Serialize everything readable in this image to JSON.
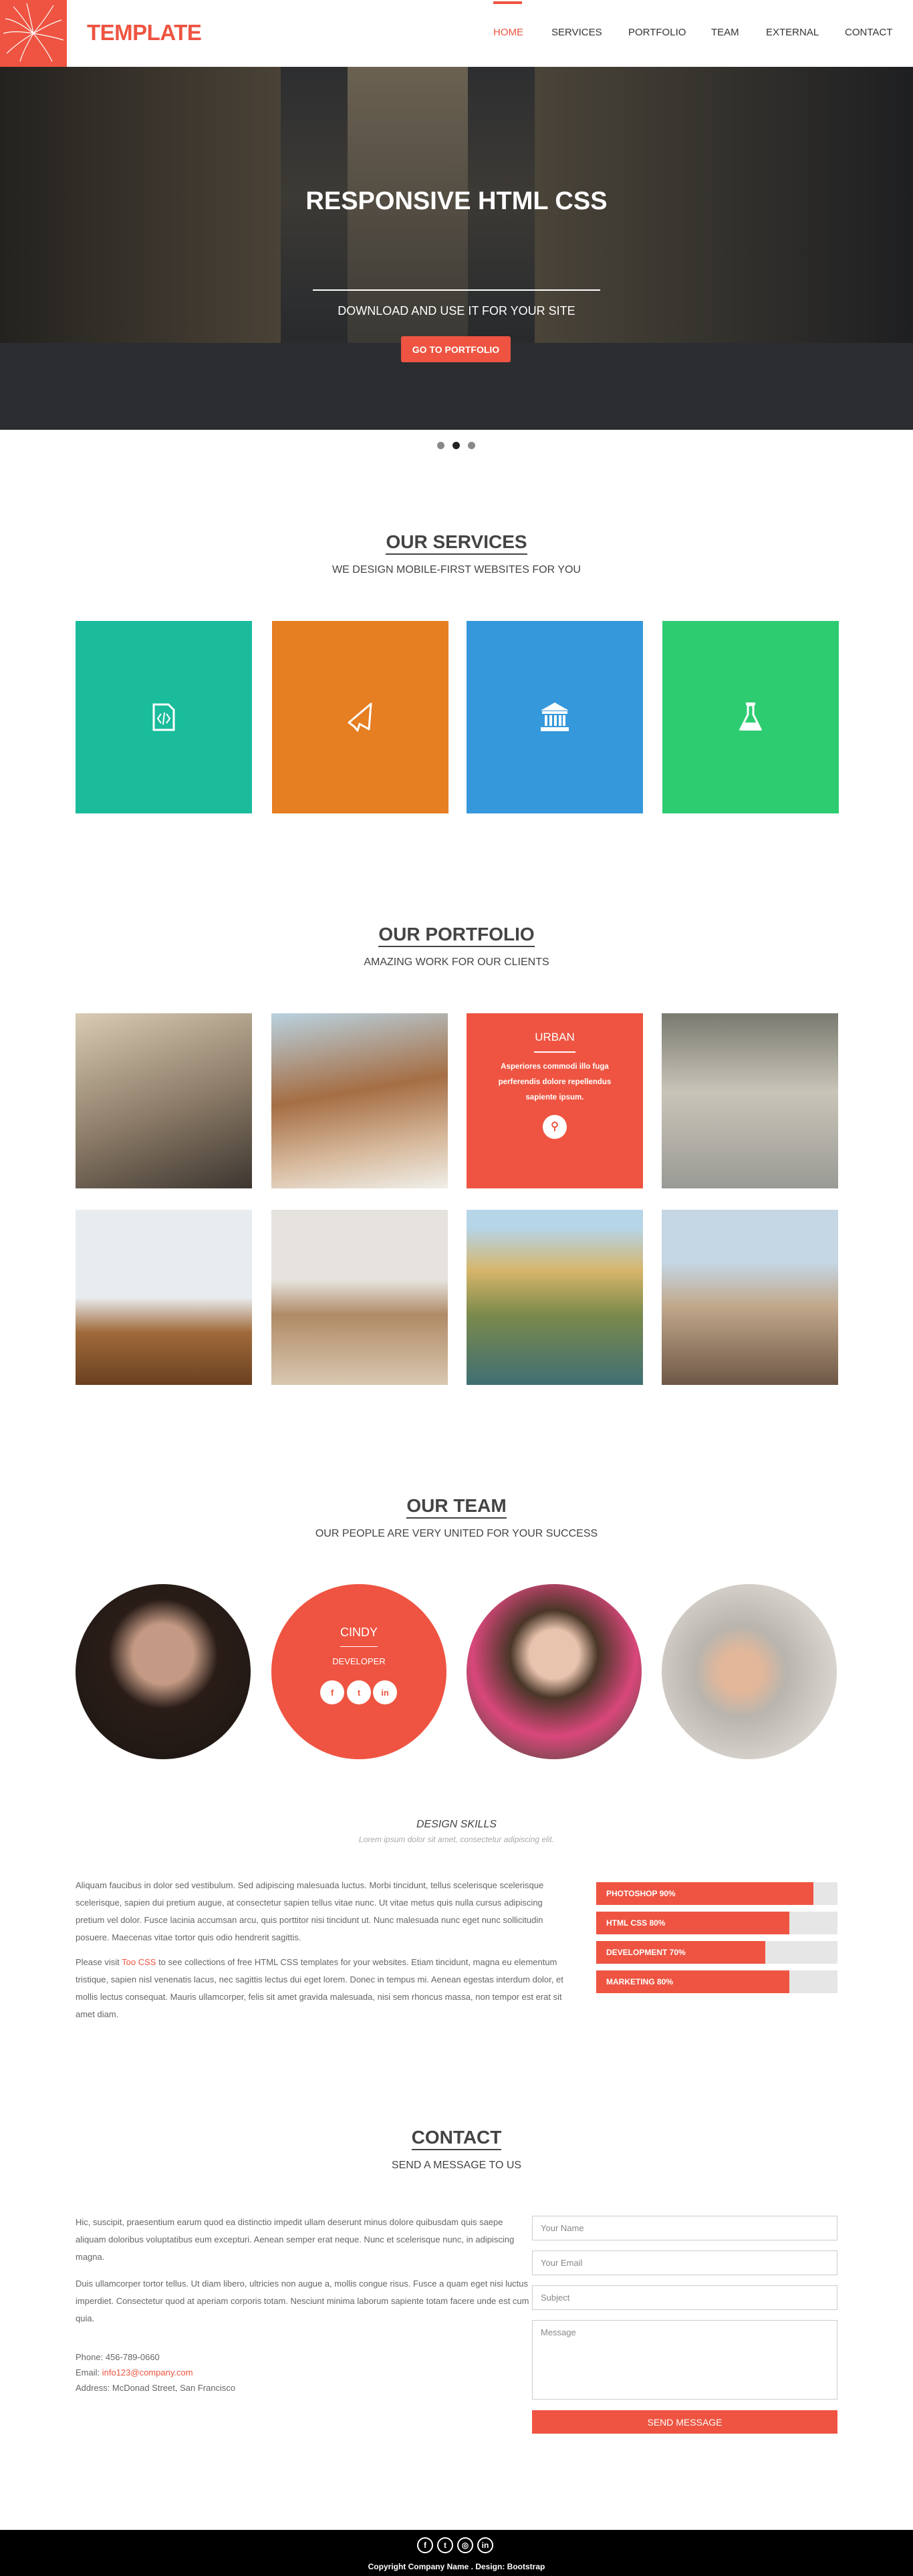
{
  "header": {
    "brand": "TEMPLATE",
    "nav": [
      {
        "label": "HOME",
        "active": true
      },
      {
        "label": "SERVICES"
      },
      {
        "label": "PORTFOLIO"
      },
      {
        "label": "TEAM"
      },
      {
        "label": "EXTERNAL"
      },
      {
        "label": "CONTACT"
      }
    ]
  },
  "hero": {
    "title": "RESPONSIVE HTML CSS",
    "subtitle": "DOWNLOAD AND USE IT FOR YOUR SITE",
    "button": "GO TO PORTFOLIO",
    "active_slide": 2,
    "slides": 3
  },
  "services": {
    "title": "OUR SERVICES",
    "subtitle": "WE DESIGN MOBILE-FIRST WEBSITES FOR YOU",
    "tiles": [
      {
        "icon": "file-code-icon",
        "color": "#1abc9c"
      },
      {
        "icon": "paper-plane-icon",
        "color": "#e67e22"
      },
      {
        "icon": "bank-icon",
        "color": "#3498db"
      },
      {
        "icon": "flask-icon",
        "color": "#2ecc71"
      }
    ]
  },
  "portfolio": {
    "title": "OUR PORTFOLIO",
    "subtitle": "AMAZING WORK FOR OUR CLIENTS",
    "hover": {
      "title": "URBAN",
      "text": "Asperiores commodi illo fuga perferendis dolore repellendus sapiente ipsum."
    }
  },
  "team": {
    "title": "OUR TEAM",
    "subtitle": "OUR PEOPLE ARE VERY UNITED FOR YOUR SUCCESS",
    "hover": {
      "name": "CINDY",
      "role": "DEVELOPER"
    },
    "skills_title": "DESIGN SKILLS",
    "skills_subtitle": "Lorem ipsum dolor sit amet, consectetur adipiscing elit.",
    "para1": "Aliquam faucibus in dolor sed vestibulum. Sed adipiscing malesuada luctus. Morbi tincidunt, tellus scelerisque scelerisque scelerisque, sapien dui pretium augue, at consectetur sapien tellus vitae nunc. Ut vitae metus quis nulla cursus adipiscing pretium vel dolor. Fusce lacinia accumsan arcu, quis porttitor nisi tincidunt ut. Nunc malesuada nunc eget nunc sollicitudin posuere. Maecenas vitae tortor quis odio hendrerit sagittis.",
    "para2_pre": "Please visit ",
    "para2_link": "Too CSS",
    "para2_post": " to see collections of free HTML CSS templates for your websites. Etiam tincidunt, magna eu elementum tristique, sapien nisl venenatis lacus, nec sagittis lectus dui eget lorem. Donec in tempus mi. Aenean egestas interdum dolor, et mollis lectus consequat. Mauris ullamcorper, felis sit amet gravida malesuada, nisi sem rhoncus massa, non tempor est erat sit amet diam.",
    "skills": [
      {
        "label": "PHOTOSHOP 90%",
        "value": 90
      },
      {
        "label": "HTML CSS 80%",
        "value": 80
      },
      {
        "label": "DEVELOPMENT 70%",
        "value": 70
      },
      {
        "label": "MARKETING 80%",
        "value": 80
      }
    ]
  },
  "contact": {
    "title": "CONTACT",
    "subtitle": "SEND A MESSAGE TO US",
    "para1": "Hic, suscipit, praesentium earum quod ea distinctio impedit ullam deserunt minus dolore quibusdam quis saepe aliquam doloribus voluptatibus eum excepturi. Aenean semper erat neque. Nunc et scelerisque nunc, in adipiscing magna.",
    "para2": "Duis ullamcorper tortor tellus. Ut diam libero, ultricies non augue a, mollis congue risus. Fusce a quam eget nisi luctus imperdiet. Consectetur quod at aperiam corporis totam. Nesciunt minima laborum sapiente totam facere unde est cum quia.",
    "phone": "Phone: 456-789-0660",
    "email_label": "Email: ",
    "email": "info123@company.com",
    "address": "Address: McDonad Street, San Francisco",
    "form": {
      "name": "Your Name",
      "email": "Your Email",
      "subject": "Subject",
      "message": "Message",
      "button": "SEND MESSAGE"
    }
  },
  "footer": {
    "copyright": "Copyright Company Name . Design: Bootstrap"
  }
}
